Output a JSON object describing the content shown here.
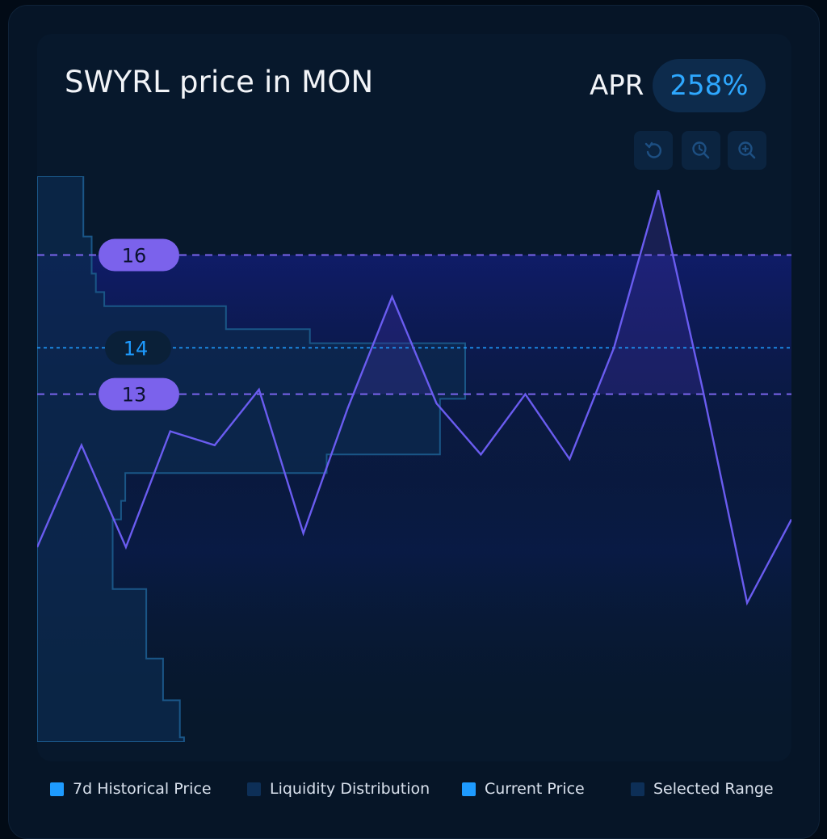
{
  "header": {
    "title": "SWYRL price in MON",
    "apr_label": "APR",
    "apr_value": "258%"
  },
  "toolbar": {
    "icons": [
      "reset-icon",
      "zoom-out-icon",
      "zoom-in-icon"
    ]
  },
  "colors": {
    "historical": "#6a5cf0",
    "range": "#7a64ec",
    "liquidity": "#0d2f57",
    "current": "#1e9bff",
    "background": "#07182c"
  },
  "chart_data": {
    "type": "line",
    "title": "SWYRL price in MON",
    "ylim": [
      5.5,
      17.7
    ],
    "range_min_label": "13",
    "range_max_label": "16",
    "current_price_label": "14",
    "range_min": 13,
    "range_max": 16,
    "current_price": 14,
    "series": [
      {
        "name": "7d Historical Price",
        "values": [
          9.7,
          11.9,
          9.7,
          12.2,
          11.9,
          13.1,
          10.0,
          12.7,
          15.1,
          12.8,
          11.7,
          13.0,
          11.6,
          14.0,
          17.4,
          13.1,
          8.5,
          10.3
        ]
      }
    ],
    "liquidity_distribution": {
      "name": "Liquidity Distribution",
      "price_levels": [
        17.7,
        16.4,
        15.6,
        15.2,
        14.9,
        14.4,
        14.1,
        13.5,
        12.9,
        11.7,
        11.3,
        10.7,
        10.3,
        8.8,
        7.3,
        6.4,
        5.6
      ],
      "liquidity": [
        1.1,
        1.3,
        1.4,
        1.6,
        4.5,
        6.5,
        10.2,
        10.2,
        9.6,
        6.9,
        2.1,
        2.0,
        1.8,
        2.6,
        3.0,
        3.4,
        3.5
      ]
    },
    "legend": [
      "7d Historical Price",
      "Liquidity Distribution",
      "Current Price",
      "Selected Range"
    ],
    "legend_position": "bottom"
  }
}
